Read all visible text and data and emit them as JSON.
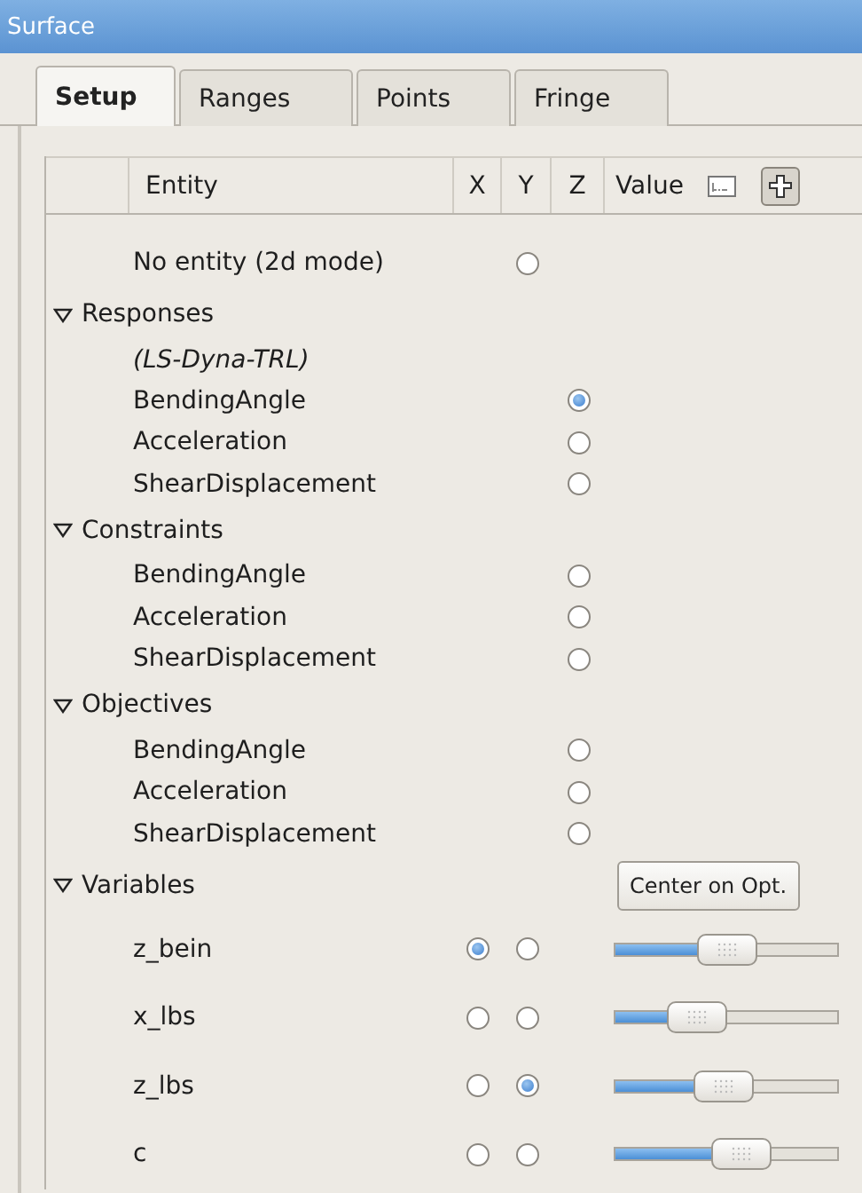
{
  "window": {
    "title": "Surface"
  },
  "tabs": [
    {
      "label": "Setup",
      "selected": true
    },
    {
      "label": "Ranges",
      "selected": false
    },
    {
      "label": "Points",
      "selected": false
    },
    {
      "label": "Fringe",
      "selected": false
    }
  ],
  "table": {
    "columns": [
      "Entity",
      "X",
      "Y",
      "Z",
      "Value"
    ],
    "value_toggle": {
      "on": true
    }
  },
  "no_entity": {
    "label": "No entity (2d mode)",
    "y": {
      "selected": false
    }
  },
  "sections": [
    {
      "label": "Responses",
      "expanded": true,
      "children": [
        {
          "kind": "note",
          "label": "(LS-Dyna-TRL)"
        },
        {
          "kind": "entity",
          "label": "BendingAngle",
          "z": {
            "selected": true
          }
        },
        {
          "kind": "entity",
          "label": "Acceleration",
          "z": {
            "selected": false
          }
        },
        {
          "kind": "entity",
          "label": "ShearDisplacement",
          "z": {
            "selected": false
          }
        }
      ]
    },
    {
      "label": "Constraints",
      "expanded": true,
      "children": [
        {
          "kind": "entity",
          "label": "BendingAngle",
          "z": {
            "selected": false
          }
        },
        {
          "kind": "entity",
          "label": "Acceleration",
          "z": {
            "selected": false
          }
        },
        {
          "kind": "entity",
          "label": "ShearDisplacement",
          "z": {
            "selected": false
          }
        }
      ]
    },
    {
      "label": "Objectives",
      "expanded": true,
      "children": [
        {
          "kind": "entity",
          "label": "BendingAngle",
          "z": {
            "selected": false
          }
        },
        {
          "kind": "entity",
          "label": "Acceleration",
          "z": {
            "selected": false
          }
        },
        {
          "kind": "entity",
          "label": "ShearDisplacement",
          "z": {
            "selected": false
          }
        }
      ]
    },
    {
      "label": "Variables",
      "expanded": true,
      "button": "Center on Opt.",
      "children": [
        {
          "kind": "variable",
          "label": "z_bein",
          "x": {
            "selected": true
          },
          "y": {
            "selected": false
          },
          "level": 0.5
        },
        {
          "kind": "variable",
          "label": "x_lbs",
          "x": {
            "selected": false
          },
          "y": {
            "selected": false
          },
          "level": 0.37
        },
        {
          "kind": "variable",
          "label": "z_lbs",
          "x": {
            "selected": false
          },
          "y": {
            "selected": true
          },
          "level": 0.49
        },
        {
          "kind": "variable",
          "label": "c",
          "x": {
            "selected": false
          },
          "y": {
            "selected": false
          },
          "level": 0.57
        }
      ]
    }
  ]
}
